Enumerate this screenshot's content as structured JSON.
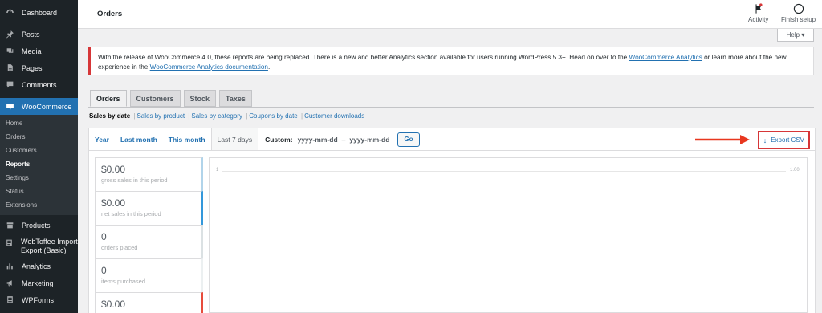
{
  "sidebar": {
    "items_top": [
      {
        "label": "Dashboard",
        "icon": "dashboard-icon"
      },
      {
        "label": "Posts",
        "icon": "pin-icon"
      },
      {
        "label": "Media",
        "icon": "media-icon"
      },
      {
        "label": "Pages",
        "icon": "page-icon"
      },
      {
        "label": "Comments",
        "icon": "comment-icon"
      }
    ],
    "woocommerce": {
      "label": "WooCommerce",
      "icon": "woo-icon"
    },
    "submenu": [
      "Home",
      "Orders",
      "Customers",
      "Reports",
      "Settings",
      "Status",
      "Extensions"
    ],
    "submenu_current": "Reports",
    "items_bottom": [
      {
        "label": "Products",
        "icon": "box-icon"
      },
      {
        "label": "WebToffee Import Export (Basic)",
        "icon": "import-export-icon"
      },
      {
        "label": "Analytics",
        "icon": "bar-chart-icon"
      },
      {
        "label": "Marketing",
        "icon": "megaphone-icon"
      },
      {
        "label": "WPForms",
        "icon": "form-icon"
      }
    ]
  },
  "topbar": {
    "title": "Orders",
    "activity": "Activity",
    "finish_setup": "Finish setup",
    "help": "Help ▾"
  },
  "notice": {
    "text1": "With the release of WooCommerce 4.0, these reports are being replaced. There is a new and better Analytics section available for users running WordPress 5.3+. Head on over to the ",
    "link1": "WooCommerce Analytics",
    "text2": " or learn more about the new experience in the ",
    "link2": "WooCommerce Analytics documentation",
    "text3": "."
  },
  "tabs": [
    "Orders",
    "Customers",
    "Stock",
    "Taxes"
  ],
  "active_tab": "Orders",
  "subnav": {
    "current": "Sales by date",
    "links": [
      "Sales by product",
      "Sales by category",
      "Coupons by date",
      "Customer downloads"
    ]
  },
  "range": {
    "tabs": [
      "Year",
      "Last month",
      "This month",
      "Last 7 days"
    ],
    "active": "Last 7 days",
    "custom_label": "Custom:",
    "from_placeholder": "yyyy-mm-dd",
    "dash": "–",
    "to_placeholder": "yyyy-mm-dd",
    "go": "Go",
    "export": "Export CSV"
  },
  "legend": [
    {
      "value": "$0.00",
      "label": "gross sales in this period",
      "color": "#b1d4ea"
    },
    {
      "value": "$0.00",
      "label": "net sales in this period",
      "color": "#3498db"
    },
    {
      "value": "0",
      "label": "orders placed",
      "color": "#dbe1e3"
    },
    {
      "value": "0",
      "label": "items purchased",
      "color": "#ecf0f1"
    },
    {
      "value": "$0.00",
      "label": "",
      "color": "#e74c3c"
    }
  ],
  "chart": {
    "tick_left": "1",
    "tick_right": "1.00"
  },
  "colors": {
    "accent": "#2271b1",
    "sidebar_bg": "#1d2327",
    "highlight_red": "#d63638",
    "arrow_red": "#e8371f"
  }
}
